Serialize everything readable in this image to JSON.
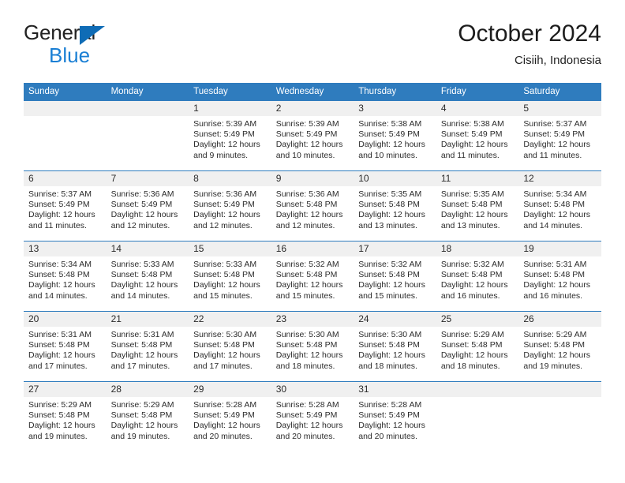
{
  "brand": {
    "name_line1": "General",
    "name_line2": "Blue",
    "triangle_color": "#0f6cb6",
    "blue_text_color": "#1a7fd4"
  },
  "header": {
    "title": "October 2024",
    "location": "Cisiih, Indonesia"
  },
  "theme": {
    "header_bar_color": "#2f7cbe",
    "daynum_band_color": "#f0f0f0",
    "row_divider_color": "#2f7cbe",
    "text_color": "#2b2b2b",
    "page_background": "#ffffff"
  },
  "weekday_headers": [
    "Sunday",
    "Monday",
    "Tuesday",
    "Wednesday",
    "Thursday",
    "Friday",
    "Saturday"
  ],
  "labels": {
    "sunrise_prefix": "Sunrise:",
    "sunset_prefix": "Sunset:",
    "daylight_prefix": "Daylight:"
  },
  "weeks": [
    [
      {
        "day": "",
        "sunrise": "",
        "sunset": "",
        "daylight": ""
      },
      {
        "day": "",
        "sunrise": "",
        "sunset": "",
        "daylight": ""
      },
      {
        "day": "1",
        "sunrise": "Sunrise: 5:39 AM",
        "sunset": "Sunset: 5:49 PM",
        "daylight": "Daylight: 12 hours and 9 minutes."
      },
      {
        "day": "2",
        "sunrise": "Sunrise: 5:39 AM",
        "sunset": "Sunset: 5:49 PM",
        "daylight": "Daylight: 12 hours and 10 minutes."
      },
      {
        "day": "3",
        "sunrise": "Sunrise: 5:38 AM",
        "sunset": "Sunset: 5:49 PM",
        "daylight": "Daylight: 12 hours and 10 minutes."
      },
      {
        "day": "4",
        "sunrise": "Sunrise: 5:38 AM",
        "sunset": "Sunset: 5:49 PM",
        "daylight": "Daylight: 12 hours and 11 minutes."
      },
      {
        "day": "5",
        "sunrise": "Sunrise: 5:37 AM",
        "sunset": "Sunset: 5:49 PM",
        "daylight": "Daylight: 12 hours and 11 minutes."
      }
    ],
    [
      {
        "day": "6",
        "sunrise": "Sunrise: 5:37 AM",
        "sunset": "Sunset: 5:49 PM",
        "daylight": "Daylight: 12 hours and 11 minutes."
      },
      {
        "day": "7",
        "sunrise": "Sunrise: 5:36 AM",
        "sunset": "Sunset: 5:49 PM",
        "daylight": "Daylight: 12 hours and 12 minutes."
      },
      {
        "day": "8",
        "sunrise": "Sunrise: 5:36 AM",
        "sunset": "Sunset: 5:49 PM",
        "daylight": "Daylight: 12 hours and 12 minutes."
      },
      {
        "day": "9",
        "sunrise": "Sunrise: 5:36 AM",
        "sunset": "Sunset: 5:48 PM",
        "daylight": "Daylight: 12 hours and 12 minutes."
      },
      {
        "day": "10",
        "sunrise": "Sunrise: 5:35 AM",
        "sunset": "Sunset: 5:48 PM",
        "daylight": "Daylight: 12 hours and 13 minutes."
      },
      {
        "day": "11",
        "sunrise": "Sunrise: 5:35 AM",
        "sunset": "Sunset: 5:48 PM",
        "daylight": "Daylight: 12 hours and 13 minutes."
      },
      {
        "day": "12",
        "sunrise": "Sunrise: 5:34 AM",
        "sunset": "Sunset: 5:48 PM",
        "daylight": "Daylight: 12 hours and 14 minutes."
      }
    ],
    [
      {
        "day": "13",
        "sunrise": "Sunrise: 5:34 AM",
        "sunset": "Sunset: 5:48 PM",
        "daylight": "Daylight: 12 hours and 14 minutes."
      },
      {
        "day": "14",
        "sunrise": "Sunrise: 5:33 AM",
        "sunset": "Sunset: 5:48 PM",
        "daylight": "Daylight: 12 hours and 14 minutes."
      },
      {
        "day": "15",
        "sunrise": "Sunrise: 5:33 AM",
        "sunset": "Sunset: 5:48 PM",
        "daylight": "Daylight: 12 hours and 15 minutes."
      },
      {
        "day": "16",
        "sunrise": "Sunrise: 5:32 AM",
        "sunset": "Sunset: 5:48 PM",
        "daylight": "Daylight: 12 hours and 15 minutes."
      },
      {
        "day": "17",
        "sunrise": "Sunrise: 5:32 AM",
        "sunset": "Sunset: 5:48 PM",
        "daylight": "Daylight: 12 hours and 15 minutes."
      },
      {
        "day": "18",
        "sunrise": "Sunrise: 5:32 AM",
        "sunset": "Sunset: 5:48 PM",
        "daylight": "Daylight: 12 hours and 16 minutes."
      },
      {
        "day": "19",
        "sunrise": "Sunrise: 5:31 AM",
        "sunset": "Sunset: 5:48 PM",
        "daylight": "Daylight: 12 hours and 16 minutes."
      }
    ],
    [
      {
        "day": "20",
        "sunrise": "Sunrise: 5:31 AM",
        "sunset": "Sunset: 5:48 PM",
        "daylight": "Daylight: 12 hours and 17 minutes."
      },
      {
        "day": "21",
        "sunrise": "Sunrise: 5:31 AM",
        "sunset": "Sunset: 5:48 PM",
        "daylight": "Daylight: 12 hours and 17 minutes."
      },
      {
        "day": "22",
        "sunrise": "Sunrise: 5:30 AM",
        "sunset": "Sunset: 5:48 PM",
        "daylight": "Daylight: 12 hours and 17 minutes."
      },
      {
        "day": "23",
        "sunrise": "Sunrise: 5:30 AM",
        "sunset": "Sunset: 5:48 PM",
        "daylight": "Daylight: 12 hours and 18 minutes."
      },
      {
        "day": "24",
        "sunrise": "Sunrise: 5:30 AM",
        "sunset": "Sunset: 5:48 PM",
        "daylight": "Daylight: 12 hours and 18 minutes."
      },
      {
        "day": "25",
        "sunrise": "Sunrise: 5:29 AM",
        "sunset": "Sunset: 5:48 PM",
        "daylight": "Daylight: 12 hours and 18 minutes."
      },
      {
        "day": "26",
        "sunrise": "Sunrise: 5:29 AM",
        "sunset": "Sunset: 5:48 PM",
        "daylight": "Daylight: 12 hours and 19 minutes."
      }
    ],
    [
      {
        "day": "27",
        "sunrise": "Sunrise: 5:29 AM",
        "sunset": "Sunset: 5:48 PM",
        "daylight": "Daylight: 12 hours and 19 minutes."
      },
      {
        "day": "28",
        "sunrise": "Sunrise: 5:29 AM",
        "sunset": "Sunset: 5:48 PM",
        "daylight": "Daylight: 12 hours and 19 minutes."
      },
      {
        "day": "29",
        "sunrise": "Sunrise: 5:28 AM",
        "sunset": "Sunset: 5:49 PM",
        "daylight": "Daylight: 12 hours and 20 minutes."
      },
      {
        "day": "30",
        "sunrise": "Sunrise: 5:28 AM",
        "sunset": "Sunset: 5:49 PM",
        "daylight": "Daylight: 12 hours and 20 minutes."
      },
      {
        "day": "31",
        "sunrise": "Sunrise: 5:28 AM",
        "sunset": "Sunset: 5:49 PM",
        "daylight": "Daylight: 12 hours and 20 minutes."
      },
      {
        "day": "",
        "sunrise": "",
        "sunset": "",
        "daylight": ""
      },
      {
        "day": "",
        "sunrise": "",
        "sunset": "",
        "daylight": ""
      }
    ]
  ]
}
